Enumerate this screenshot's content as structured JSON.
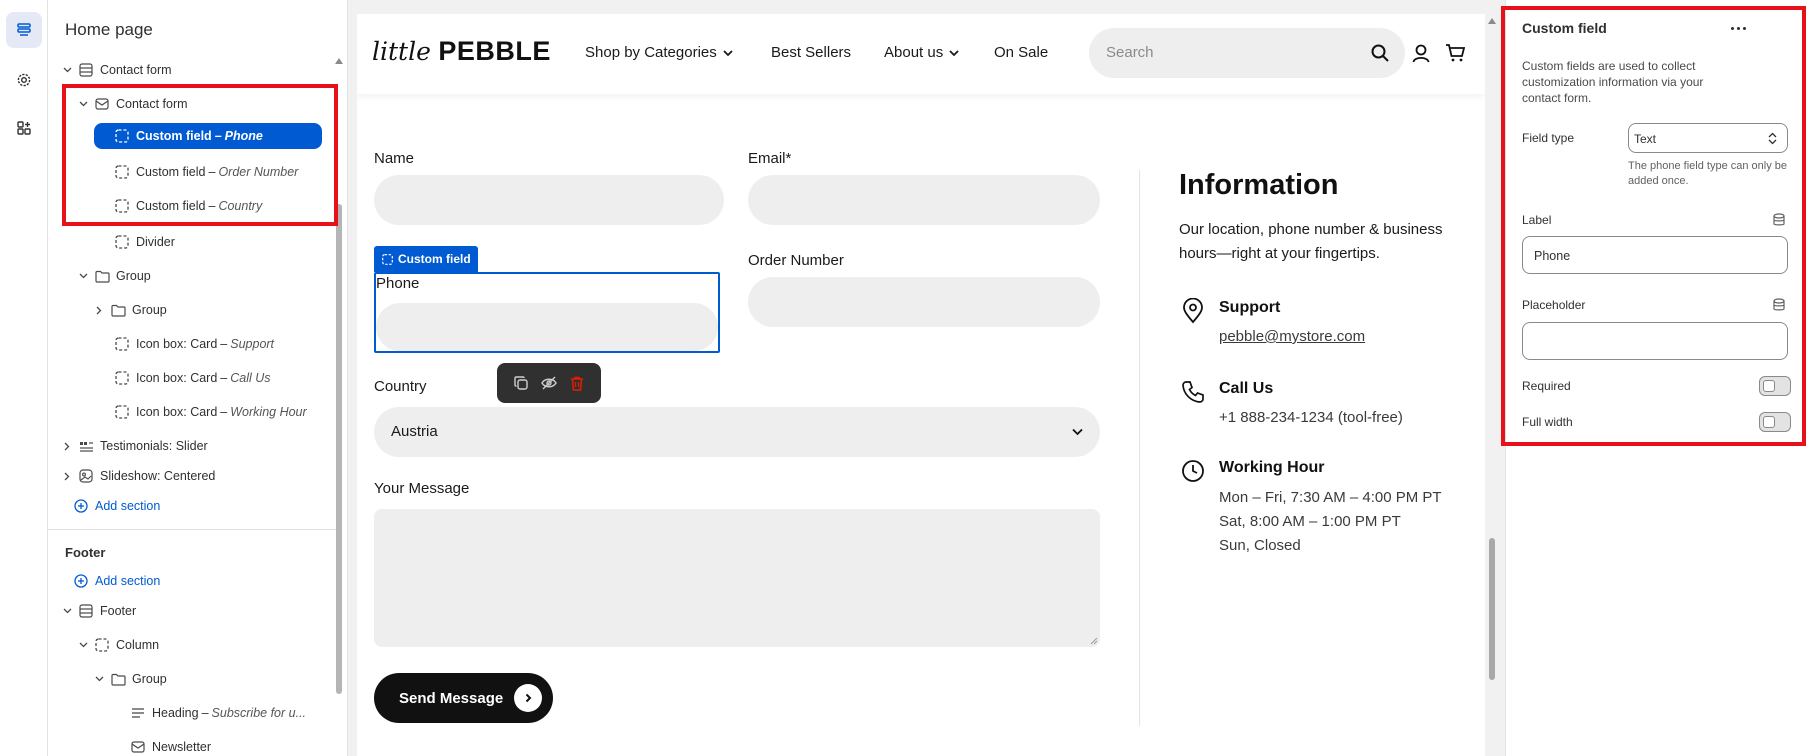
{
  "rail": {
    "items": [
      {
        "name": "sections",
        "icon": "layers-icon"
      },
      {
        "name": "settings",
        "icon": "gear-icon"
      },
      {
        "name": "apps",
        "icon": "apps-icon"
      }
    ]
  },
  "sidebar": {
    "title": "Home page",
    "tree": [
      {
        "label": "Contact form",
        "sub": "",
        "icon": "section-icon",
        "chev": "down"
      },
      {
        "label": "Contact form",
        "sub": "",
        "icon": "form-icon",
        "chev": "down"
      },
      {
        "label": "Custom field",
        "sub": "Phone",
        "icon": "field-icon",
        "chev": "",
        "selected": true
      },
      {
        "label": "Custom field",
        "sub": "Order Number",
        "icon": "field-icon",
        "chev": ""
      },
      {
        "label": "Custom field",
        "sub": "Country",
        "icon": "field-icon",
        "chev": ""
      },
      {
        "label": "Divider",
        "sub": "",
        "icon": "field-icon",
        "chev": ""
      },
      {
        "label": "Group",
        "sub": "",
        "icon": "folder-icon",
        "chev": "down"
      },
      {
        "label": "Group",
        "sub": "",
        "icon": "folder-icon",
        "chev": "right"
      },
      {
        "label": "Icon box: Card",
        "sub": "Support",
        "icon": "field-icon",
        "chev": ""
      },
      {
        "label": "Icon box: Card",
        "sub": "Call Us",
        "icon": "field-icon",
        "chev": ""
      },
      {
        "label": "Icon box: Card",
        "sub": "Working Hour",
        "icon": "field-icon",
        "chev": ""
      },
      {
        "label": "Testimonials: Slider",
        "sub": "",
        "icon": "testimonial-icon",
        "chev": "right"
      },
      {
        "label": "Slideshow: Centered",
        "sub": "",
        "icon": "slideshow-icon",
        "chev": "right"
      }
    ],
    "add_section": "Add section",
    "footer_heading": "Footer",
    "footer_add_section": "Add section",
    "footer_tree": [
      {
        "label": "Footer",
        "sub": "",
        "icon": "section-icon",
        "chev": "down"
      },
      {
        "label": "Column",
        "sub": "",
        "icon": "field-icon",
        "chev": "down"
      },
      {
        "label": "Group",
        "sub": "",
        "icon": "folder-icon",
        "chev": "down"
      },
      {
        "label": "Heading",
        "sub": "Subscribe for u...",
        "icon": "heading-icon",
        "chev": ""
      },
      {
        "label": "Newsletter",
        "sub": "",
        "icon": "form-icon",
        "chev": ""
      }
    ],
    "dash": "–"
  },
  "store": {
    "logo_script": "little",
    "logo_bold": "PEBBLE",
    "nav": [
      "Shop by Categories",
      "Best Sellers",
      "About us",
      "On Sale"
    ],
    "search_placeholder": "Search",
    "form": {
      "name_label": "Name",
      "email_label": "Email*",
      "phone_tag": "Custom field",
      "phone_label": "Phone",
      "order_label": "Order Number",
      "country_label": "Country",
      "country_value": "Austria",
      "message_label": "Your Message",
      "send_label": "Send Message"
    },
    "info": {
      "title": "Information",
      "desc": "Our location, phone number & business hours—right at your fingertips.",
      "support_head": "Support",
      "support_email": "pebble@mystore.com",
      "call_head": "Call Us",
      "call_number": "+1 888-234-1234 (tool-free)",
      "hours_head": "Working Hour",
      "hours": [
        "Mon – Fri, 7:30 AM – 4:00 PM PT",
        "Sat, 8:00 AM – 1:00 PM PT",
        "Sun, Closed"
      ]
    }
  },
  "settings": {
    "title": "Custom field",
    "description": "Custom fields are used to collect customization information via your contact form.",
    "field_type_label": "Field type",
    "field_type_value": "Text",
    "field_type_help": "The phone field type can only be added once.",
    "label_label": "Label",
    "label_value": "Phone",
    "placeholder_label": "Placeholder",
    "placeholder_value": "",
    "required_label": "Required",
    "required_on": false,
    "full_width_label": "Full width",
    "full_width_on": false
  },
  "colors": {
    "accent": "#005bd3",
    "highlight": "#e8101a",
    "button_dark": "#111111"
  }
}
